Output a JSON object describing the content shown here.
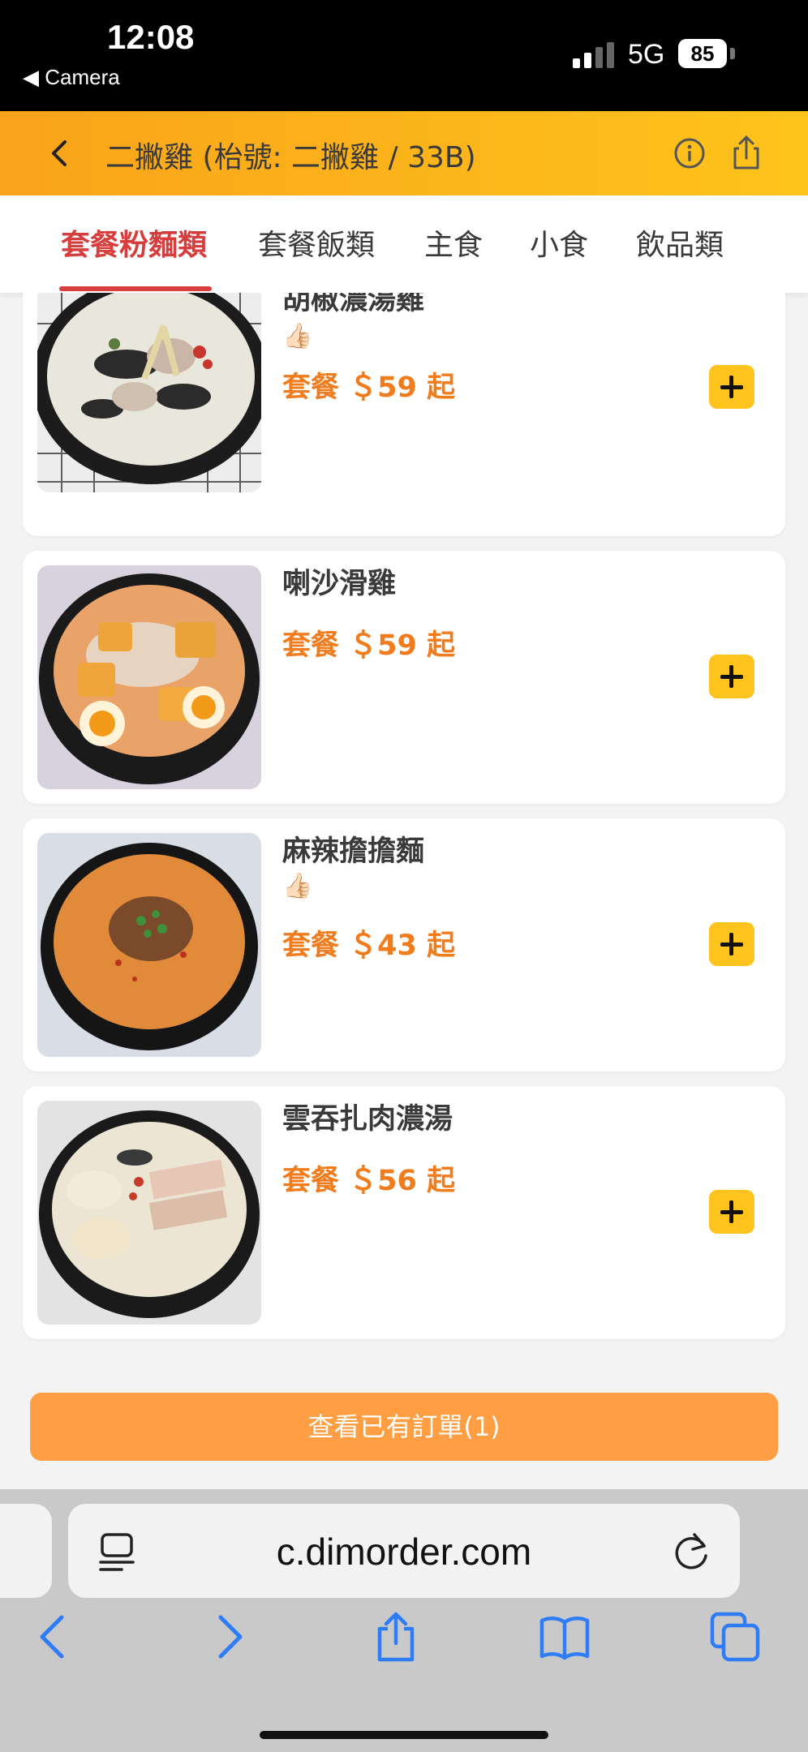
{
  "status_bar": {
    "time": "12:08",
    "back_label": "◀ Camera",
    "network": "5G",
    "battery": "85"
  },
  "header": {
    "title": "二撇雞 (枱號: 二撇雞 / 33B)"
  },
  "tabs": [
    {
      "label": "套餐粉麵類",
      "active": true
    },
    {
      "label": "套餐飯類",
      "active": false
    },
    {
      "label": "主食",
      "active": false
    },
    {
      "label": "小食",
      "active": false
    },
    {
      "label": "飲品類",
      "active": false
    }
  ],
  "items": [
    {
      "name": "胡椒濃湯雞",
      "recommended": "👍🏻",
      "price": "套餐 ＄59 起"
    },
    {
      "name": "喇沙滑雞",
      "price": "套餐 ＄59 起"
    },
    {
      "name": "麻辣擔擔麵",
      "recommended": "👍🏻",
      "price": "套餐 ＄43 起"
    },
    {
      "name": "雲吞扎肉濃湯",
      "price": "套餐 ＄56 起"
    }
  ],
  "orders_button": "查看已有訂單(1)",
  "browser": {
    "url": "c.dimorder.com"
  },
  "colors": {
    "accent": "#f07c1e",
    "tab_active": "#d63d3d",
    "header_from": "#f9a31a",
    "header_to": "#ffc41c",
    "add_button": "#ffc31e",
    "orders_button": "#ff9e43"
  }
}
